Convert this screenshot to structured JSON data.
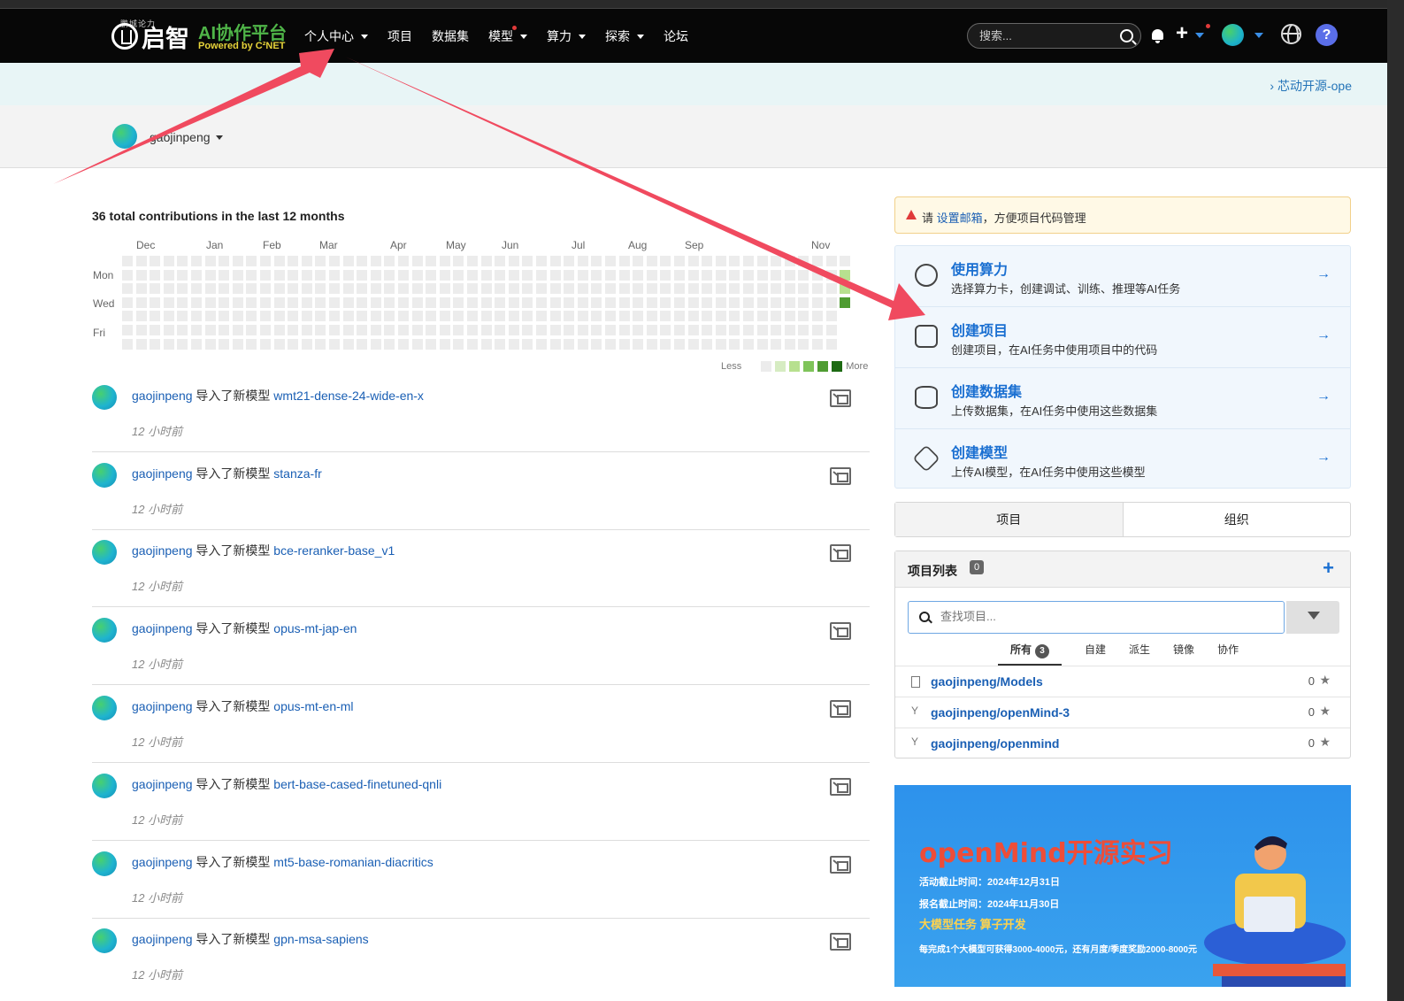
{
  "navbar": {
    "logo_tiny": "鹏城论力",
    "logo_cn": "启智",
    "logo_ai": "AI协作平台",
    "logo_powered": "Powered by C²NET",
    "menu": [
      {
        "label": "个人中心",
        "caret": true
      },
      {
        "label": "项目",
        "caret": false
      },
      {
        "label": "数据集",
        "caret": false
      },
      {
        "label": "模型",
        "caret": true
      },
      {
        "label": "算力",
        "caret": true
      },
      {
        "label": "探索",
        "caret": true
      },
      {
        "label": "论坛",
        "caret": false
      }
    ],
    "search_placeholder": "搜索...",
    "help_label": "?"
  },
  "notice": {
    "text": "› 芯动开源-ope"
  },
  "user": {
    "name": "gaojinpeng"
  },
  "contributions": {
    "title": "36 total contributions in the last 12 months",
    "months": [
      "Dec",
      "Jan",
      "Feb",
      "Mar",
      "Apr",
      "May",
      "Jun",
      "Jul",
      "Aug",
      "Sep",
      "Nov"
    ],
    "days": [
      "Mon",
      "Wed",
      "Fri"
    ],
    "legend_less": "Less",
    "legend_more": "More",
    "legend_colors": [
      "#ececec",
      "#d6ecc2",
      "#b7e08f",
      "#7fc45a",
      "#4f9c32",
      "#1d6a13"
    ]
  },
  "feed": [
    {
      "user": "gaojinpeng",
      "action": " 导入了新模型 ",
      "model": "wmt21-dense-24-wide-en-x",
      "time": "12 小时前"
    },
    {
      "user": "gaojinpeng",
      "action": " 导入了新模型 ",
      "model": "stanza-fr",
      "time": "12 小时前"
    },
    {
      "user": "gaojinpeng",
      "action": " 导入了新模型 ",
      "model": "bce-reranker-base_v1",
      "time": "12 小时前"
    },
    {
      "user": "gaojinpeng",
      "action": " 导入了新模型 ",
      "model": "opus-mt-jap-en",
      "time": "12 小时前"
    },
    {
      "user": "gaojinpeng",
      "action": " 导入了新模型 ",
      "model": "opus-mt-en-ml",
      "time": "12 小时前"
    },
    {
      "user": "gaojinpeng",
      "action": " 导入了新模型 ",
      "model": "bert-base-cased-finetuned-qnli",
      "time": "12 小时前"
    },
    {
      "user": "gaojinpeng",
      "action": " 导入了新模型 ",
      "model": "mt5-base-romanian-diacritics",
      "time": "12 小时前"
    },
    {
      "user": "gaojinpeng",
      "action": " 导入了新模型 ",
      "model": "gpn-msa-sapiens",
      "time": "12 小时前"
    }
  ],
  "warning": {
    "pre": "请 ",
    "link": "设置邮箱",
    "post": "，方便项目代码管理"
  },
  "quick_actions": [
    {
      "title": "使用算力",
      "desc": "选择算力卡，创建调试、训练、推理等AI任务",
      "icon": "compute-icon"
    },
    {
      "title": "创建项目",
      "desc": "创建项目，在AI任务中使用项目中的代码",
      "icon": "code-project-icon"
    },
    {
      "title": "创建数据集",
      "desc": "上传数据集，在AI任务中使用这些数据集",
      "icon": "database-icon"
    },
    {
      "title": "创建模型",
      "desc": "上传AI模型，在AI任务中使用这些模型",
      "icon": "model-cube-icon"
    }
  ],
  "side_tabs": {
    "projects": "项目",
    "orgs": "组织"
  },
  "projects": {
    "title": "项目列表",
    "count": "0",
    "search_placeholder": "查找项目...",
    "filters": [
      {
        "label": "所有",
        "count": "3"
      },
      {
        "label": "自建"
      },
      {
        "label": "派生"
      },
      {
        "label": "镜像"
      },
      {
        "label": "协作"
      }
    ],
    "items": [
      {
        "name": "gaojinpeng/Models",
        "stars": "0",
        "icon": "repo-icon"
      },
      {
        "name": "gaojinpeng/openMind-3",
        "stars": "0",
        "icon": "fork-icon"
      },
      {
        "name": "gaojinpeng/openmind",
        "stars": "0",
        "icon": "fork-icon"
      }
    ]
  },
  "promo": {
    "headline": "openMind开源实习",
    "line1": "活动截止时间：2024年12月31日",
    "line2": "报名截止时间：2024年11月30日",
    "tags": "大模型任务   算子开发",
    "line3": "每完成1个大模型可获得3000-4000元，还有月度/季度奖励2000-8000元"
  }
}
